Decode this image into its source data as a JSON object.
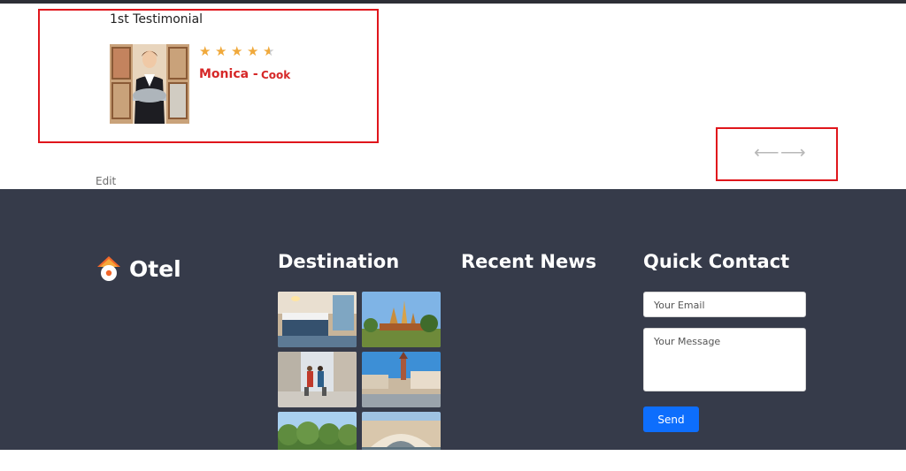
{
  "testimonial": {
    "title": "1st Testimonial",
    "rating": 4.5,
    "name": "Monica -",
    "role": "Cook",
    "star_color": "#f0a93b",
    "name_color": "#d62828"
  },
  "slider": {
    "prev_icon": "arrow-left-icon",
    "next_icon": "arrow-right-icon",
    "prev_glyph": "⟵",
    "next_glyph": "⟶"
  },
  "edit_label": "Edit",
  "footer": {
    "background": "#363b4a",
    "logo_text": "Otel",
    "columns": {
      "destination": "Destination",
      "recent_news": "Recent News",
      "quick_contact": "Quick Contact"
    },
    "destination_images": [
      "hotel-room",
      "city-landmark",
      "travelers-street",
      "venice-palace",
      "forest-trees",
      "rialto-bridge"
    ],
    "contact": {
      "email_placeholder": "Your Email",
      "message_placeholder": "Your Message",
      "send_label": "Send",
      "send_color": "#0d6efd"
    }
  }
}
